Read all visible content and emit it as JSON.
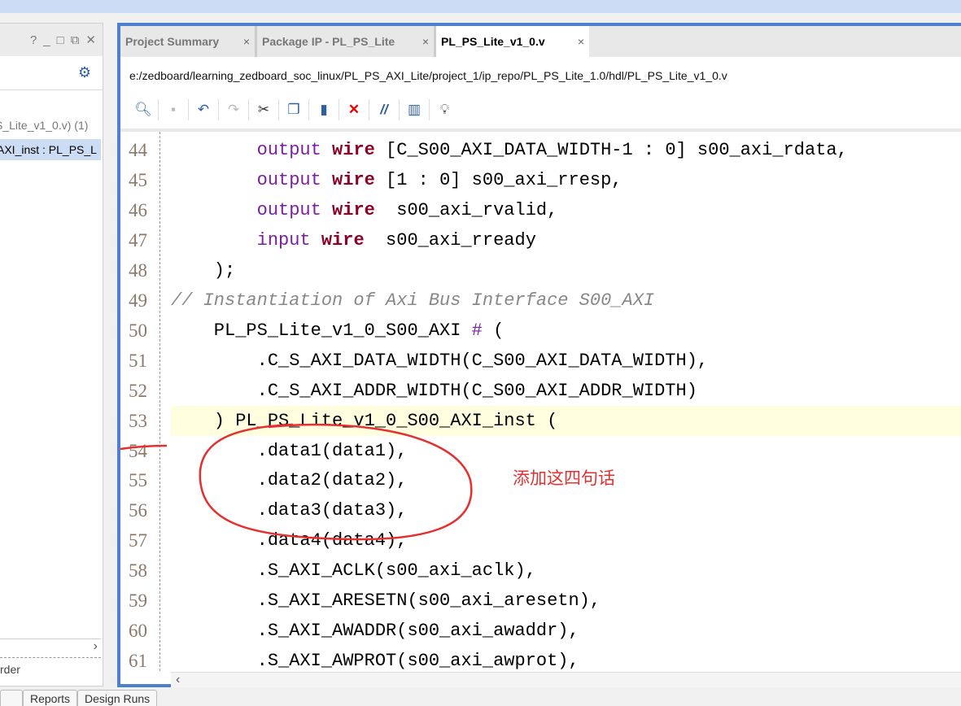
{
  "left_panel": {
    "header_icons": [
      "help-icon",
      "minimize-icon",
      "maximize-icon",
      "float-icon",
      "close-icon"
    ],
    "items": [
      "S_Lite_v1_0.v) (1)",
      "AXI_inst : PL_PS_L"
    ],
    "footer": "rder"
  },
  "bottom_tabs": [
    "",
    "Reports",
    "Design Runs"
  ],
  "editor": {
    "tabs": [
      {
        "label": "Project Summary",
        "active": false
      },
      {
        "label": "Package IP - PL_PS_Lite",
        "active": false
      },
      {
        "label": "PL_PS_Lite_v1_0.v",
        "active": true
      }
    ],
    "close_glyph": "×",
    "path": "e:/zedboard/learning_zedboard_soc_linux/PL_PS_AXI_Lite/project_1/ip_repo/PL_PS_Lite_1.0/hdl/PL_PS_Lite_v1_0.v",
    "toolbar": [
      "search-icon",
      "save-icon",
      "undo-icon",
      "redo-icon",
      "cut-icon",
      "copy-icon",
      "paste-icon",
      "delete-icon",
      "comment-icon",
      "columns-icon",
      "hint-icon"
    ],
    "highlight_line": 53,
    "lines": [
      {
        "n": "44",
        "segs": [
          [
            "        ",
            ""
          ],
          [
            "output",
            "io"
          ],
          [
            " ",
            ""
          ],
          [
            "wire",
            "w"
          ],
          [
            " [C_S00_AXI_DATA_WIDTH-1 : 0] s00_axi_rdata,",
            ""
          ]
        ]
      },
      {
        "n": "45",
        "segs": [
          [
            "        ",
            ""
          ],
          [
            "output",
            "io"
          ],
          [
            " ",
            ""
          ],
          [
            "wire",
            "w"
          ],
          [
            " [1 : 0] s00_axi_rresp,",
            ""
          ]
        ]
      },
      {
        "n": "46",
        "segs": [
          [
            "        ",
            ""
          ],
          [
            "output",
            "io"
          ],
          [
            " ",
            ""
          ],
          [
            "wire",
            "w"
          ],
          [
            "  s00_axi_rvalid,",
            ""
          ]
        ]
      },
      {
        "n": "47",
        "segs": [
          [
            "        ",
            ""
          ],
          [
            "input",
            "io"
          ],
          [
            " ",
            ""
          ],
          [
            "wire",
            "w"
          ],
          [
            "  s00_axi_rready",
            ""
          ]
        ]
      },
      {
        "n": "48",
        "segs": [
          [
            "    );",
            ""
          ]
        ]
      },
      {
        "n": "49",
        "segs": [
          [
            "// Instantiation of Axi Bus Interface S00_AXI",
            "c"
          ]
        ]
      },
      {
        "n": "50",
        "segs": [
          [
            "    PL_PS_Lite_v1_0_S00_AXI ",
            ""
          ],
          [
            "#",
            "io"
          ],
          [
            " (",
            ""
          ]
        ]
      },
      {
        "n": "51",
        "segs": [
          [
            "        .C_S_AXI_DATA_WIDTH(C_S00_AXI_DATA_WIDTH),",
            ""
          ]
        ]
      },
      {
        "n": "52",
        "segs": [
          [
            "        .C_S_AXI_ADDR_WIDTH(C_S00_AXI_ADDR_WIDTH)",
            ""
          ]
        ]
      },
      {
        "n": "53",
        "segs": [
          [
            "    ) PL_PS_Lite_v1_0_S00_AXI_inst (",
            ""
          ]
        ]
      },
      {
        "n": "54",
        "segs": [
          [
            "        .data1(data1),",
            ""
          ]
        ]
      },
      {
        "n": "55",
        "segs": [
          [
            "        .data2(data2),",
            ""
          ]
        ]
      },
      {
        "n": "56",
        "segs": [
          [
            "        .data3(data3),",
            ""
          ]
        ]
      },
      {
        "n": "57",
        "segs": [
          [
            "        .data4(data4),",
            ""
          ]
        ]
      },
      {
        "n": "58",
        "segs": [
          [
            "        .S_AXI_ACLK(s00_axi_aclk),",
            ""
          ]
        ]
      },
      {
        "n": "59",
        "segs": [
          [
            "        .S_AXI_ARESETN(s00_axi_aresetn),",
            ""
          ]
        ]
      },
      {
        "n": "60",
        "segs": [
          [
            "        .S_AXI_AWADDR(s00_axi_awaddr),",
            ""
          ]
        ]
      },
      {
        "n": "61",
        "segs": [
          [
            "        .S_AXI_AWPROT(s00_axi_awprot),",
            ""
          ]
        ]
      }
    ]
  },
  "annotation": {
    "text": "添加这四句话",
    "color": "#e53030"
  }
}
